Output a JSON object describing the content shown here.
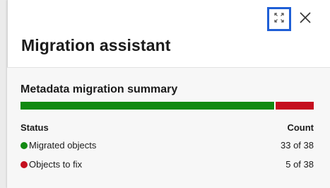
{
  "panel": {
    "title": "Migration assistant",
    "expand_icon": "expand-icon",
    "close_icon": "close-icon"
  },
  "summary": {
    "title": "Metadata migration summary",
    "progress": {
      "migrated": 33,
      "to_fix": 5,
      "total": 38,
      "colors": {
        "migrated": "#128a12",
        "to_fix": "#c50f1f"
      }
    },
    "columns": {
      "status": "Status",
      "count": "Count"
    },
    "rows": [
      {
        "label": "Migrated objects",
        "count": "33 of 38",
        "color": "#128a12"
      },
      {
        "label": "Objects to fix",
        "count": "5 of 38",
        "color": "#c50f1f"
      }
    ]
  },
  "colors": {
    "focus_outline": "#1f5fd6",
    "section_background": "#f7f7f7"
  }
}
